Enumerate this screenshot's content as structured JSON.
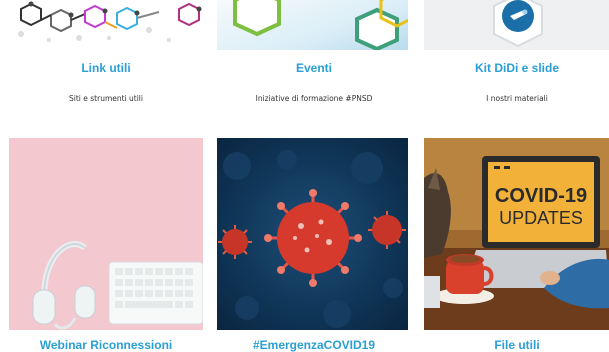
{
  "cards_top": [
    {
      "title": "Link utili",
      "desc": "Siti e strumenti utili",
      "icon": "molecule-network-icon"
    },
    {
      "title": "Eventi",
      "desc": "Iniziative di formazione #PNSD",
      "icon": "hexagon-pattern-icon"
    },
    {
      "title": "Kit DiDi e slide",
      "desc": "I nostri materiali",
      "icon": "toolkit-badge-icon"
    }
  ],
  "cards_bottom": [
    {
      "title": "Webinar Riconnessioni",
      "icon": "headphones-keyboard-image"
    },
    {
      "title": "#EmergenzaCOVID19",
      "icon": "coronavirus-image"
    },
    {
      "title": "File utili",
      "image_text_1": "COVID-19",
      "image_text_2": "UPDATES",
      "icon": "covid-updates-laptop-image"
    }
  ],
  "colors": {
    "title": "#2a9fd6",
    "pink_bg": "#f3c8cf",
    "virus_bg": "#0f3556",
    "virus_red": "#d63a2c"
  }
}
